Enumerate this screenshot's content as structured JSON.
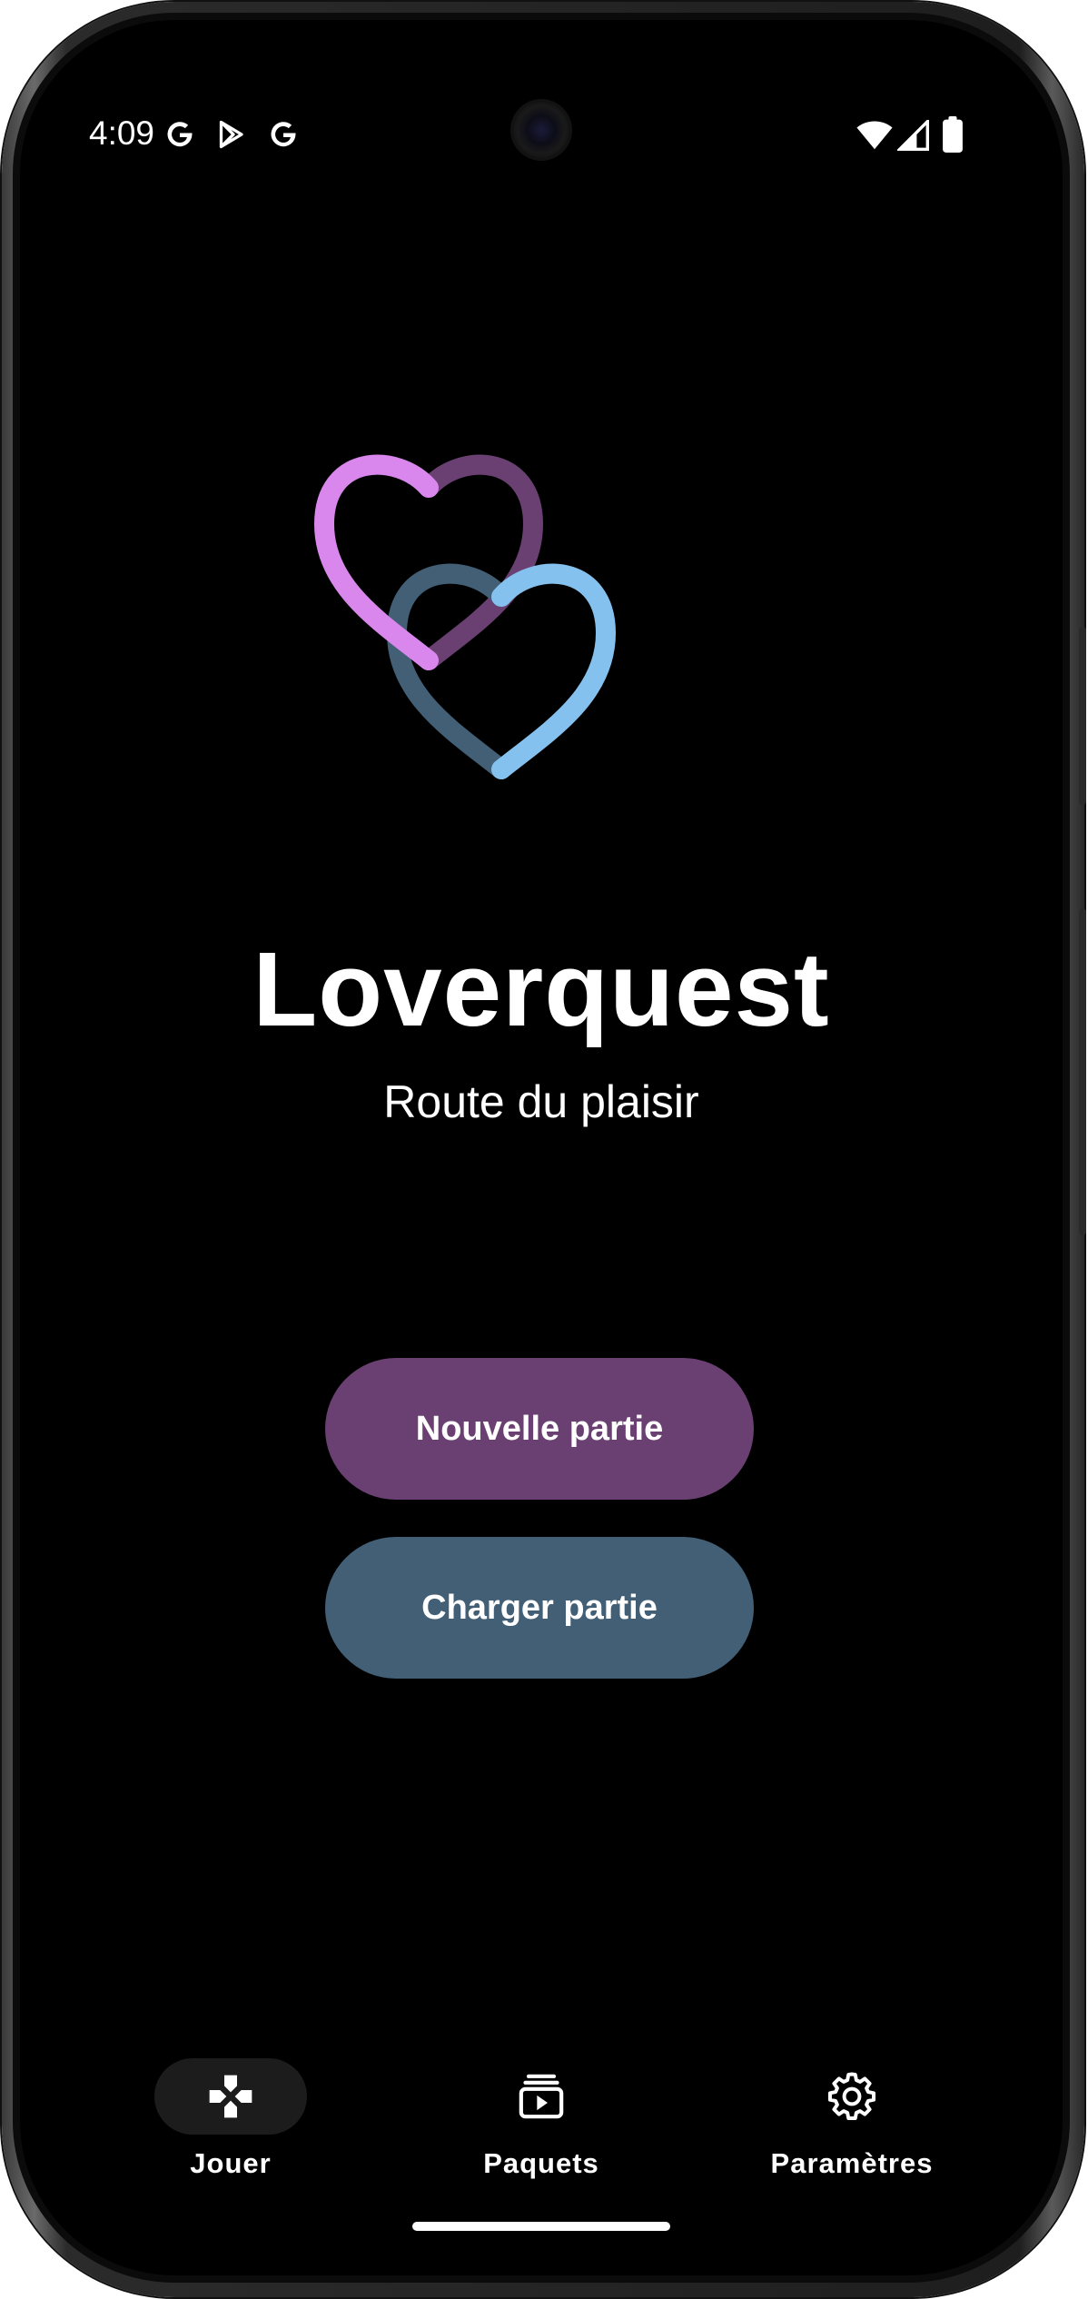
{
  "status_bar": {
    "time": "4:09",
    "left_icons": [
      "google-g-icon",
      "play-store-icon",
      "google-g-icon"
    ],
    "right_icons": [
      "wifi-icon",
      "cell-signal-icon",
      "battery-icon"
    ]
  },
  "app": {
    "title": "Loverquest",
    "subtitle": "Route du plaisir",
    "logo_colors": {
      "heart_pink": "#d987ec",
      "heart_purple": "#6a4072",
      "heart_blue": "#85c1ee",
      "heart_slate": "#425f76"
    }
  },
  "actions": {
    "new_game_label": "Nouvelle partie",
    "load_game_label": "Charger partie",
    "new_game_color": "#6a4072",
    "load_game_color": "#425f76"
  },
  "bottom_nav": {
    "items": [
      {
        "label": "Jouer",
        "icon": "gamepad-icon",
        "active": true
      },
      {
        "label": "Paquets",
        "icon": "card-stack-play-icon",
        "active": false
      },
      {
        "label": "Paramètres",
        "icon": "gear-icon",
        "active": false
      }
    ]
  }
}
